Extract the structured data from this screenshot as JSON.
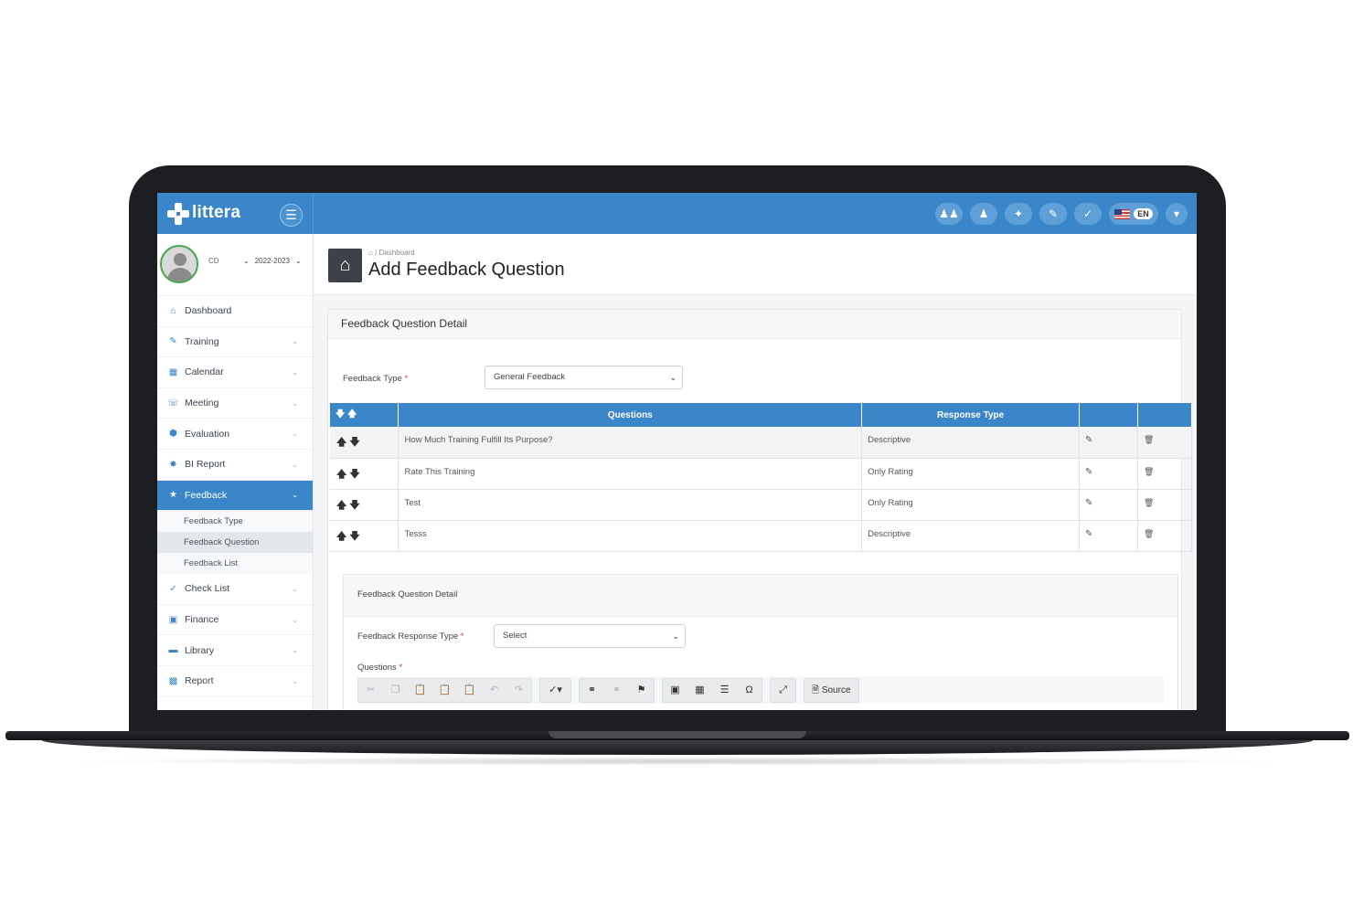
{
  "brand": {
    "name": "littera"
  },
  "header": {
    "icons": [
      "users-icon",
      "user-icon",
      "person-icon",
      "edit-check-icon",
      "check-circle-icon"
    ],
    "language": "EN"
  },
  "profile": {
    "name": "CD",
    "year": "2022-2023"
  },
  "sidebar": {
    "items": [
      {
        "label": "Dashboard",
        "icon": "home-icon"
      },
      {
        "label": "Training",
        "icon": "training-icon"
      },
      {
        "label": "Calendar",
        "icon": "calendar-icon"
      },
      {
        "label": "Meeting",
        "icon": "headset-icon"
      },
      {
        "label": "Evaluation",
        "icon": "evaluation-icon"
      },
      {
        "label": "BI Report",
        "icon": "bi-report-icon"
      },
      {
        "label": "Feedback",
        "icon": "star-icon"
      },
      {
        "label": "Check List",
        "icon": "checklist-icon"
      },
      {
        "label": "Finance",
        "icon": "money-icon"
      },
      {
        "label": "Library",
        "icon": "folder-icon"
      },
      {
        "label": "Report",
        "icon": "bar-chart-icon"
      }
    ],
    "feedback_sub": [
      "Feedback Type",
      "Feedback Question",
      "Feedback List"
    ]
  },
  "page": {
    "breadcrumb": "Dashboard",
    "title": "Add Feedback Question"
  },
  "panel": {
    "title": "Feedback Question Detail",
    "feedback_type_label": "Feedback Type",
    "feedback_type_value": "General Feedback"
  },
  "table": {
    "headers": [
      "Questions",
      "Response Type"
    ],
    "rows": [
      {
        "question": "How Much Training Fulfill Its Purpose?",
        "response": "Descriptive"
      },
      {
        "question": "Rate This Training",
        "response": "Only Rating"
      },
      {
        "question": "Test",
        "response": "Only Rating"
      },
      {
        "question": "Tesss",
        "response": "Descriptive"
      }
    ]
  },
  "detail": {
    "title": "Feedback Question Detail",
    "response_type_label": "Feedback Response Type",
    "response_type_value": "Select",
    "questions_label": "Questions",
    "source_label": "Source"
  },
  "colors": {
    "primary": "#3a86c8",
    "required": "#e2382f",
    "frame": "#1d1e21"
  }
}
